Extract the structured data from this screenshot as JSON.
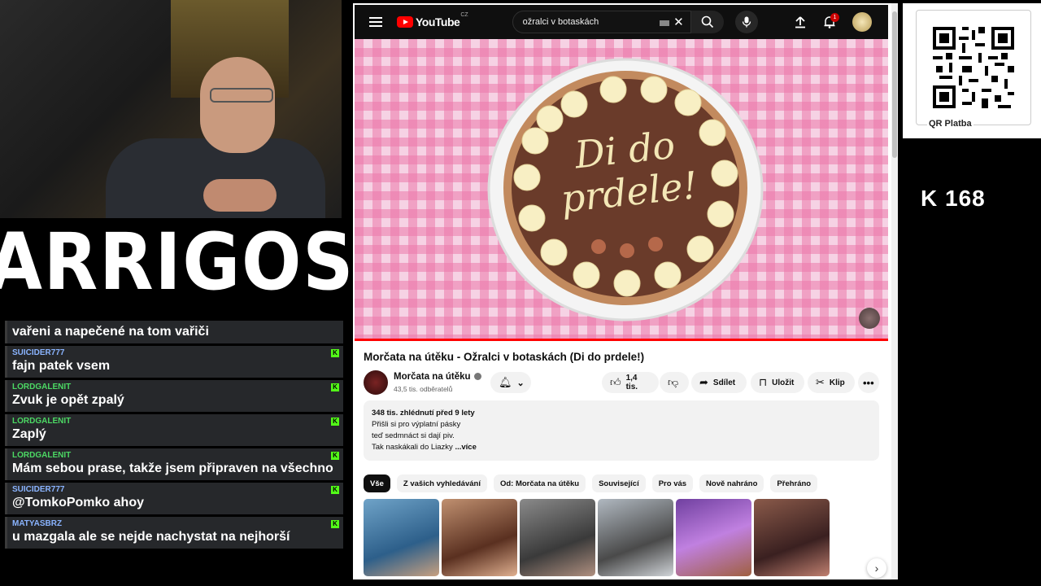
{
  "stream": {
    "logo_text": "ARRIGOS",
    "qr_label": "QR Platba",
    "counter": "K 168"
  },
  "chat": {
    "messages": [
      {
        "user": "",
        "text": "vařeni a napečené na tom vařiči"
      },
      {
        "user": "SUICIDER777",
        "text": "fajn patek vsem"
      },
      {
        "user": "LORDGALENIT",
        "text": "Zvuk je opět zpalý"
      },
      {
        "user": "LORDGALENIT",
        "text": "Zaplý"
      },
      {
        "user": "LORDGALENIT",
        "text": "Mám sebou prase, takže jsem připraven na všechno"
      },
      {
        "user": "SUICIDER777",
        "text": "@TomkoPomko ahoy"
      },
      {
        "user": "MATYASBRZ",
        "text": "u mazgala ale se nejde nachystat na nejhorší"
      }
    ],
    "kick_badge": "K"
  },
  "youtube": {
    "logo_word": "YouTube",
    "region": "CZ",
    "search_value": "ožralci v botaskách",
    "notif_count": "1",
    "cake_text": "Di do prdele!",
    "video_title": "Morčata na útěku - Ožralci v botaskách (Di do prdele!)",
    "channel_name": "Morčata na útěku",
    "channel_subs": "43,5 tis. odběratelů",
    "likes": "1,4 tis.",
    "share_label": "Sdílet",
    "save_label": "Uložit",
    "clip_label": "Klip",
    "desc_meta": "348 tis. zhlédnutí  před 9 lety",
    "desc_lines": [
      "Přišli si pro výplatní pásky",
      "teď sedmnáct si dají piv.",
      "Tak naskákali do Liazky"
    ],
    "desc_more": "...více",
    "chips": [
      "Vše",
      "Z vašich vyhledávání",
      "Od: Morčata na útěku",
      "Související",
      "Pro vás",
      "Nově nahráno",
      "Přehráno"
    ]
  },
  "colors": {
    "yt_red": "#ff0000",
    "kick_green": "#53fc18",
    "chat_bg": "#26282b"
  }
}
